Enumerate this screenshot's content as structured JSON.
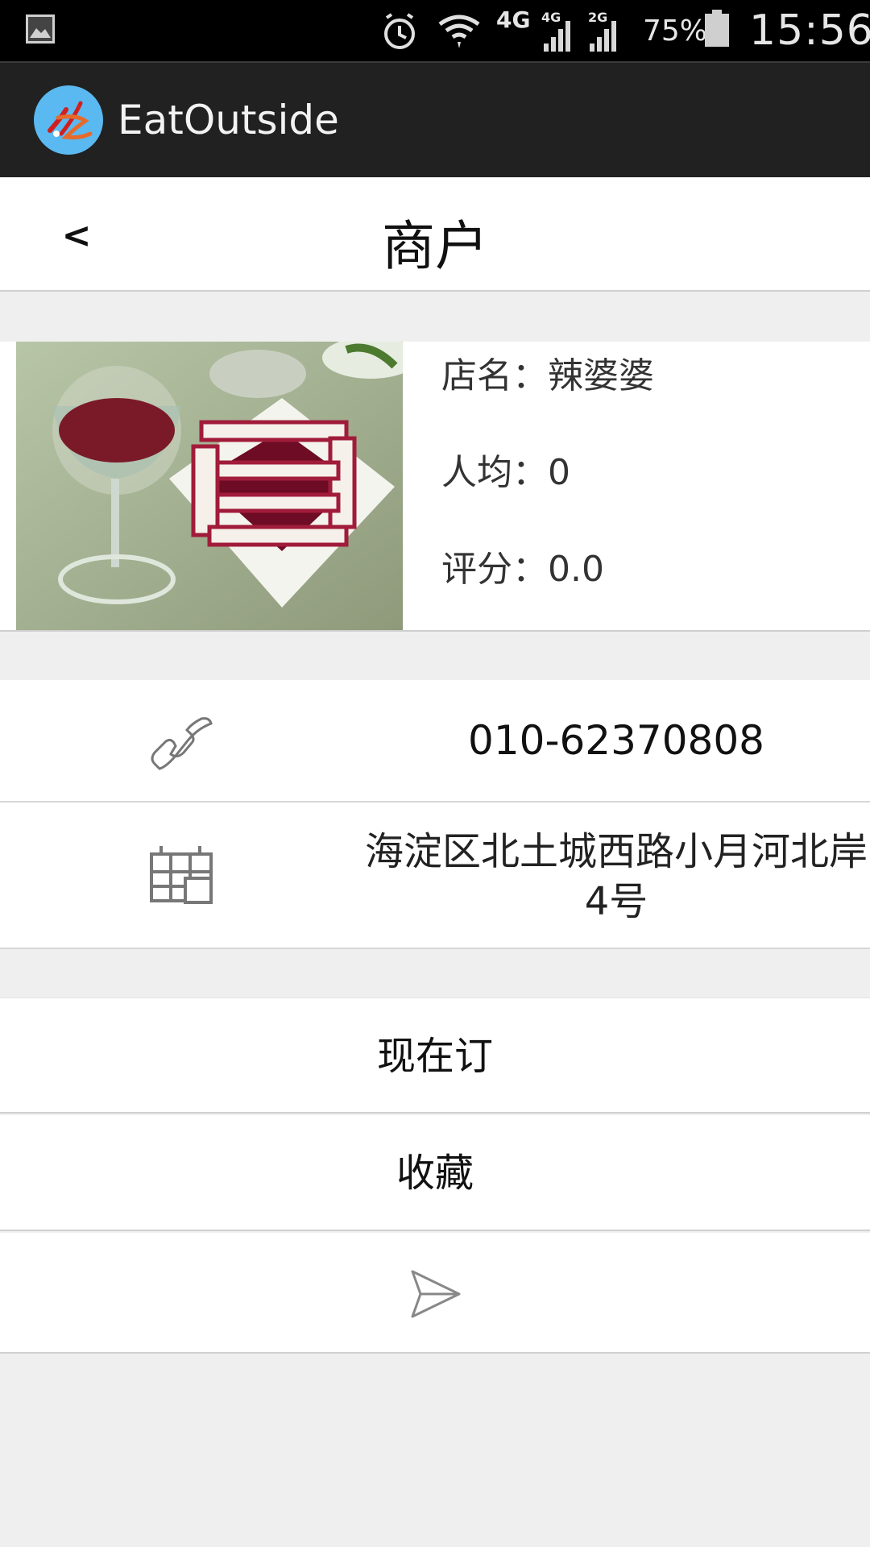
{
  "status_bar": {
    "network_label": "4G",
    "sim1_label": "4G",
    "sim2_label": "2G",
    "battery_percent": "75%",
    "time": "15:56"
  },
  "action_bar": {
    "app_name": "EatOutside"
  },
  "title_bar": {
    "back_label": "<",
    "title": "商户"
  },
  "shop": {
    "name_line": "店名：辣婆婆",
    "avg_line": "人均：0",
    "rating_line": "评分：0.0"
  },
  "contact": {
    "phone": "010-62370808",
    "address": "海淀区北土城西路小月河北岸4号"
  },
  "actions": {
    "book_label": "现在订",
    "favorite_label": "收藏"
  },
  "icons": {
    "phone": "phone-icon",
    "address": "calendar-icon",
    "share": "send-icon"
  }
}
